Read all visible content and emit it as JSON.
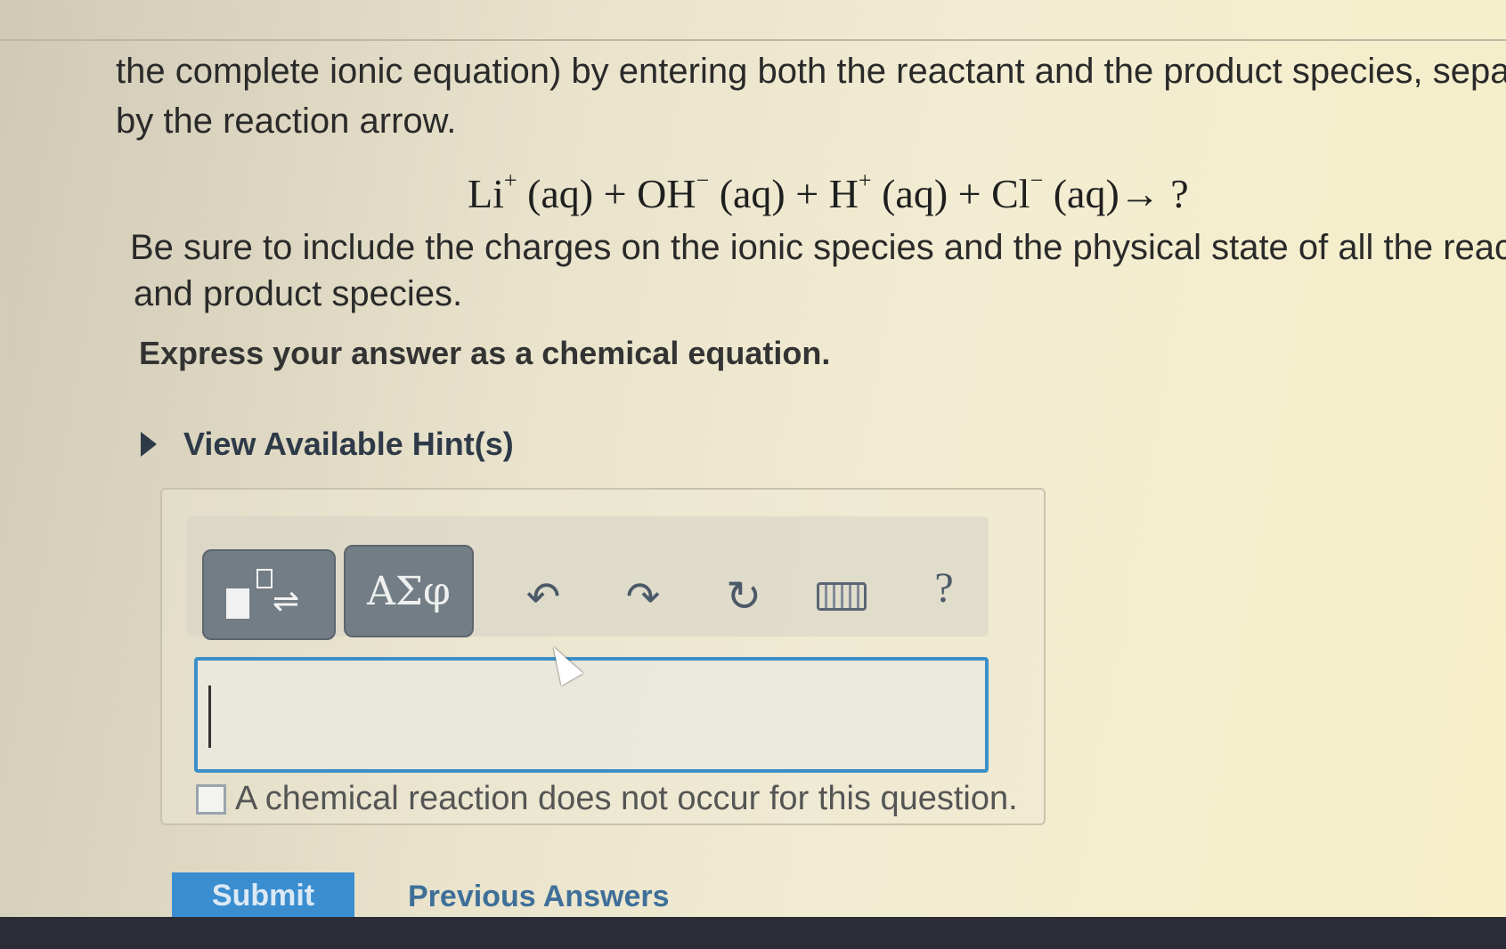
{
  "question": {
    "intro_line1": "the complete ionic equation) by entering both the reactant and the product species, sepa",
    "intro_line2": "by the reaction arrow.",
    "equation": {
      "li": "Li",
      "li_charge": "+",
      "li_state": " (aq) + ",
      "oh": "OH",
      "oh_charge": "−",
      "oh_state": " (aq) + ",
      "h": "H",
      "h_charge": "+",
      "h_state": " (aq) + ",
      "cl": "Cl",
      "cl_charge": "−",
      "cl_state": " (aq)",
      "arrow": "→",
      "result": " ?"
    },
    "note_line1": "Be sure to include the charges on the ionic species and the physical state of all the reacta",
    "note_line2": "and product species.",
    "instruction": "Express your answer as a chemical equation.",
    "hint_label": "View Available Hint(s)"
  },
  "toolbar": {
    "templates_icon": "templates-icon",
    "symbols_label": "ΑΣφ",
    "undo_glyph": "↶",
    "redo_glyph": "↷",
    "reset_glyph": "↻",
    "keyboard_icon": "keyboard-icon",
    "help_label": "?"
  },
  "answer": {
    "value": "",
    "no_reaction_label": "A chemical reaction does not occur for this question."
  },
  "actions": {
    "submit_label": "Submit",
    "previous_answers_label": "Previous Answers"
  },
  "colors": {
    "input_border": "#3b8fc8",
    "submit_bg": "#3a8ed0",
    "tool_button_bg": "#737d85"
  }
}
